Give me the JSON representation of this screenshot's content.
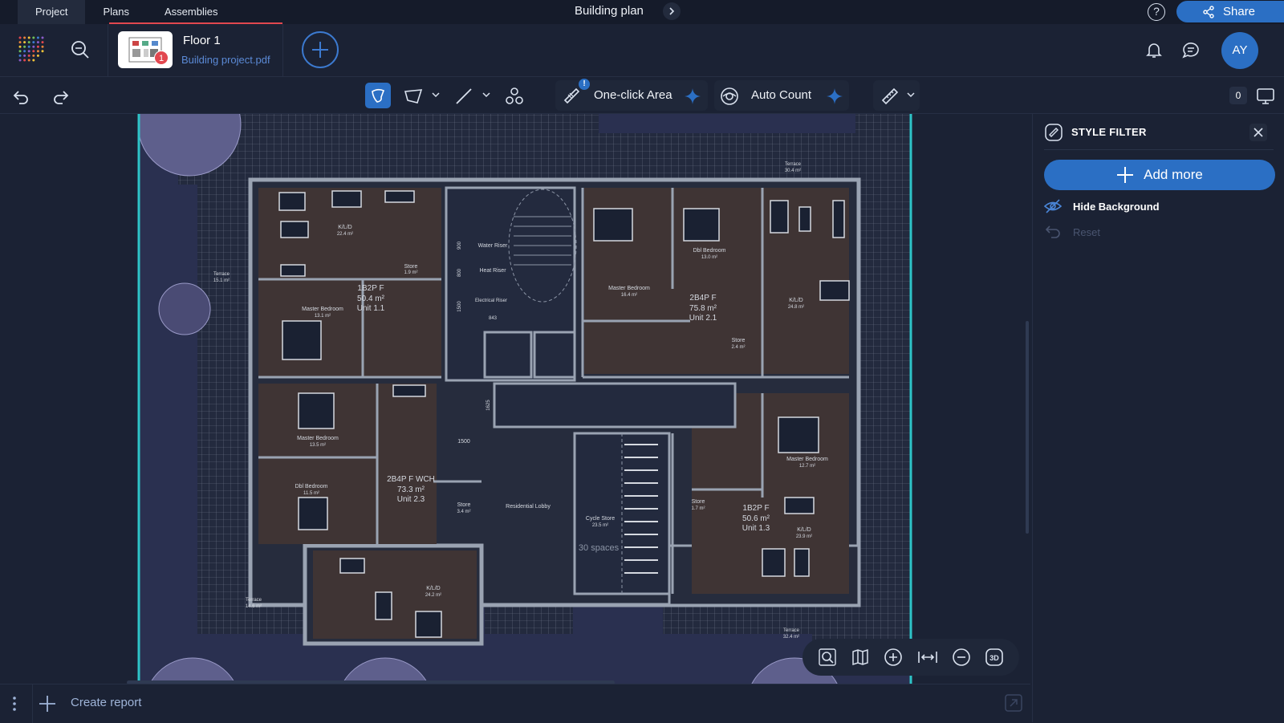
{
  "tabs": [
    {
      "label": "Project"
    },
    {
      "label": "Plans"
    },
    {
      "label": "Assemblies"
    }
  ],
  "document_title": "Building plan",
  "share_label": "Share",
  "help_label": "?",
  "plan": {
    "name": "Floor 1",
    "file": "Building project.pdf",
    "badge_count": "1"
  },
  "user_initials": "AY",
  "toolbar": {
    "one_click_area_label": "One-click Area",
    "auto_count_label": "Auto Count",
    "alert": "!",
    "count": "0"
  },
  "style_filter": {
    "title": "STYLE FILTER",
    "add_more_label": "Add more",
    "hide_background_label": "Hide Background",
    "reset_label": "Reset"
  },
  "bottom": {
    "create_report_label": "Create report"
  },
  "floor_plan": {
    "unit_labels": [
      {
        "text": "1B2P F"
      },
      {
        "text": "50.4 m²"
      },
      {
        "text": "Unit 1.1"
      },
      {
        "text": "2B4P F"
      },
      {
        "text": "75.8 m²"
      },
      {
        "text": "Unit 2.1"
      },
      {
        "text": "2B4P F WCH"
      },
      {
        "text": "73.3 m²"
      },
      {
        "text": "Unit 2.3"
      },
      {
        "text": "1B2P F"
      },
      {
        "text": "50.6 m²"
      },
      {
        "text": "Unit 1.3"
      },
      {
        "text": "30 spaces"
      }
    ],
    "room_labels": [
      {
        "text": "K/L/D"
      },
      {
        "text": "22.4 m²"
      },
      {
        "text": "Store"
      },
      {
        "text": "1.9 m²"
      },
      {
        "text": "Master Bedroom"
      },
      {
        "text": "13.1 m²"
      },
      {
        "text": "Terrace"
      },
      {
        "text": "15.1 m²"
      },
      {
        "text": "Water Riser"
      },
      {
        "text": "Heat Riser"
      },
      {
        "text": "Electrical Riser"
      },
      {
        "text": "Master Bedroom"
      },
      {
        "text": "16.4 m²"
      },
      {
        "text": "Dbl Bedroom"
      },
      {
        "text": "13.0 m²"
      },
      {
        "text": "K/L/D"
      },
      {
        "text": "24.8 m²"
      },
      {
        "text": "Store"
      },
      {
        "text": "2.4 m²"
      },
      {
        "text": "Master Bedroom"
      },
      {
        "text": "13.5 m²"
      },
      {
        "text": "Dbl Bedroom"
      },
      {
        "text": "11.5 m²"
      },
      {
        "text": "Store"
      },
      {
        "text": "3.4 m²"
      },
      {
        "text": "Residential Lobby"
      },
      {
        "text": "Cycle Store"
      },
      {
        "text": "23.5 m²"
      },
      {
        "text": "Master Bedroom"
      },
      {
        "text": "12.7 m²"
      },
      {
        "text": "Store"
      },
      {
        "text": "1.7 m²"
      },
      {
        "text": "K/L/D"
      },
      {
        "text": "23.9 m²"
      },
      {
        "text": "K/L/D"
      },
      {
        "text": "24.2 m²"
      },
      {
        "text": "Terrace"
      },
      {
        "text": "14.6 m²"
      },
      {
        "text": "Terrace"
      },
      {
        "text": "32.4 m²"
      },
      {
        "text": "Terrace"
      },
      {
        "text": "30.4 m²"
      }
    ],
    "dimensions": [
      "900",
      "800",
      "1500",
      "843",
      "1625",
      "1500"
    ]
  }
}
